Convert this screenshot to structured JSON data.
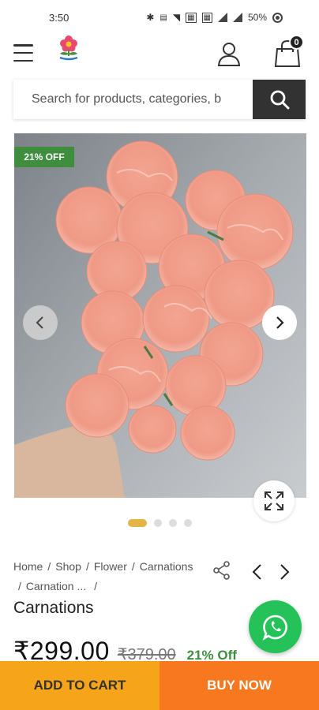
{
  "status_bar": {
    "time": "3:50",
    "battery": "50%",
    "icons": [
      "bluetooth-icon",
      "data-icon",
      "wifi-icon",
      "volte-icon",
      "volte2-icon",
      "signal-icon",
      "signal2-icon",
      "battery-icon"
    ]
  },
  "header": {
    "menu_icon": "hamburger-menu-icon",
    "logo_icon": "flower-logo-icon",
    "account_icon": "user-icon",
    "cart_icon": "shopping-bag-icon",
    "cart_count": "0"
  },
  "search": {
    "placeholder": "Search for products, categories, b",
    "button_icon": "search-icon"
  },
  "gallery": {
    "discount_badge": "21% OFF",
    "prev_icon": "chevron-left-icon",
    "next_icon": "chevron-right-icon",
    "expand_icon": "expand-icon",
    "slide_count": 4,
    "active_slide": 1
  },
  "breadcrumb": {
    "items": [
      "Home",
      "Shop",
      "Flower",
      "Carnations",
      "Carnation ..."
    ]
  },
  "product": {
    "title": "Carnations",
    "price": "₹299.00",
    "old_price": "₹379.00",
    "discount": "21% Off"
  },
  "actions": {
    "add_to_cart": "ADD TO CART",
    "buy_now": "BUY NOW",
    "whatsapp_icon": "whatsapp-icon"
  },
  "colors": {
    "accent_dark": "#323232",
    "discount_green": "#3e8e3e",
    "add_to_cart_bg": "#f6a41a",
    "buy_now_bg": "#f7781f",
    "whatsapp_green": "#25c25a",
    "active_dot": "#e2b545"
  }
}
